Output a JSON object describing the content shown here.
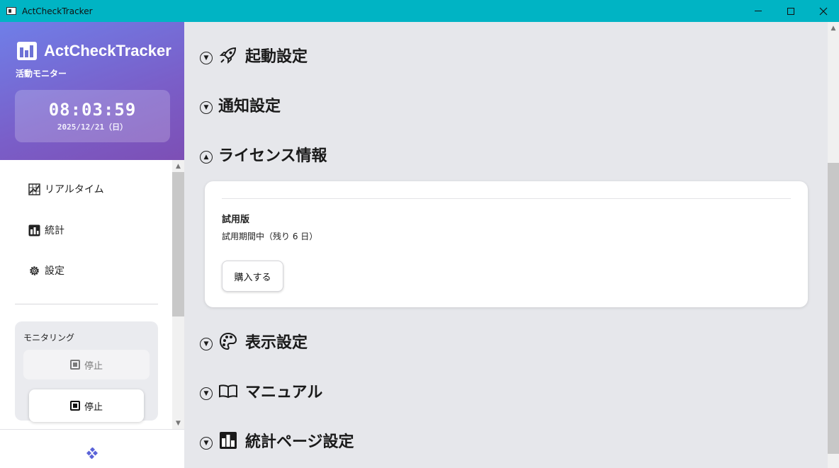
{
  "window": {
    "title": "ActCheckTracker"
  },
  "sidebar": {
    "brand_name": "ActCheckTracker",
    "brand_sub": "活動モニター",
    "clock_time": "08:03:59",
    "clock_date": "2025/12/21（日）",
    "nav": [
      {
        "label": "リアルタイム",
        "icon": "chart-grid-icon"
      },
      {
        "label": "統計",
        "icon": "bar-chart-icon"
      },
      {
        "label": "設定",
        "icon": "gear-icon"
      }
    ],
    "monitoring": {
      "title": "モニタリング",
      "stop_disabled_label": "停止",
      "stop_label": "停止"
    }
  },
  "main": {
    "sections": [
      {
        "title": "起動設定",
        "icon": "rocket-icon",
        "expanded": false
      },
      {
        "title": "通知設定",
        "icon": "",
        "expanded": false
      },
      {
        "title": "ライセンス情報",
        "icon": "",
        "expanded": true
      },
      {
        "title": "表示設定",
        "icon": "palette-icon",
        "expanded": false
      },
      {
        "title": "マニュアル",
        "icon": "book-icon",
        "expanded": false
      },
      {
        "title": "統計ページ設定",
        "icon": "bar-chart-icon",
        "expanded": false
      }
    ],
    "license": {
      "edition": "試用版",
      "trial_status": "試用期間中（残り 6 日）",
      "buy_label": "購入する"
    }
  },
  "colors": {
    "titlebar": "#00b4c4",
    "sidebar_gradient_start": "#6f7fe8",
    "sidebar_gradient_end": "#7d4fb5",
    "main_bg": "#e6e7eb"
  }
}
